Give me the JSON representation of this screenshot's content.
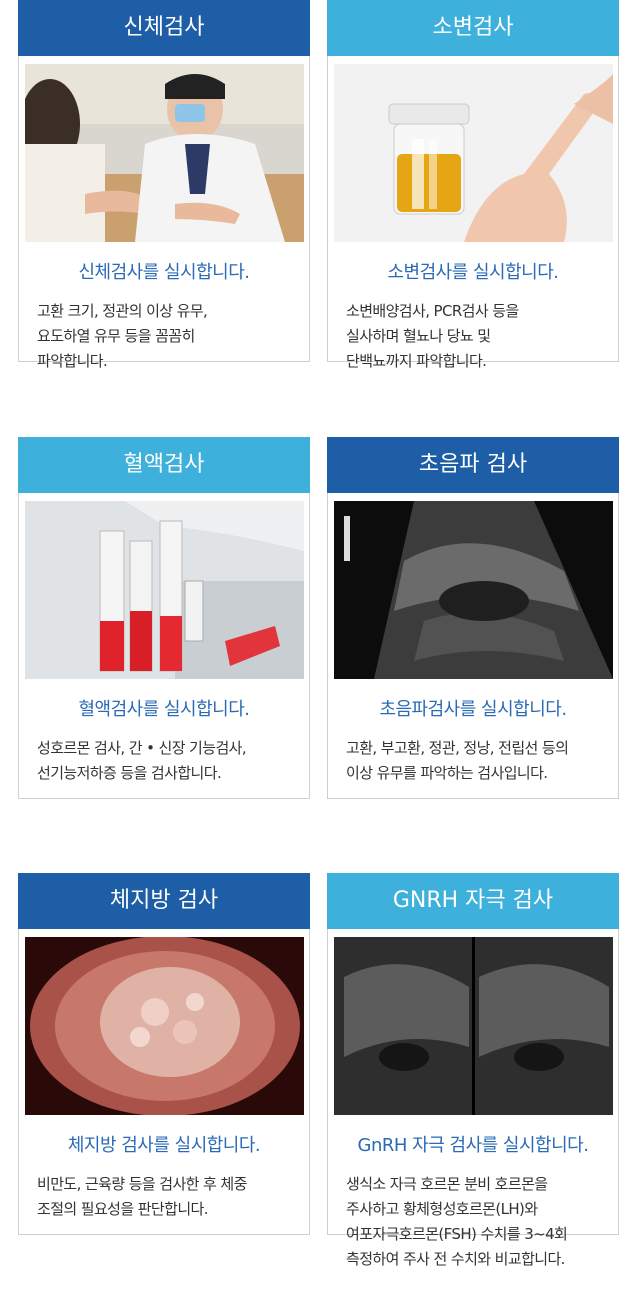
{
  "cards": [
    {
      "title": "신체검사",
      "subtitle": "신체검사를 실시합니다.",
      "desc": "고환 크기, 정관의 이상 유무,\n요도하열 유무 등을 꼼꼼히\n파악합니다.",
      "image": "physical-exam-photo"
    },
    {
      "title": "소변검사",
      "subtitle": "소변검사를 실시합니다.",
      "desc": "소변배양검사, PCR검사 등을\n실사하며 혈뇨나 당뇨 및\n단백뇨까지 파악합니다.",
      "image": "urine-sample-photo"
    },
    {
      "title": "혈액검사",
      "subtitle": "혈액검사를 실시합니다.",
      "desc": "성호르몬 검사, 간 • 신장 기능검사,\n선기능저하증 등을 검사합니다.",
      "image": "blood-tubes-photo"
    },
    {
      "title": "초음파 검사",
      "subtitle": "초음파검사를 실시합니다.",
      "desc": "고환, 부고환, 정관, 정낭, 전립선 등의\n이상 유무를 파악하는 검사입니다.",
      "image": "ultrasound-image"
    },
    {
      "title": "체지방 검사",
      "subtitle": "체지방 검사를 실시합니다.",
      "desc": "비만도, 근육량 등을 검사한 후 체중\n조절의 필요성을 판단합니다.",
      "image": "tissue-photo"
    },
    {
      "title": "GNRH 자극 검사",
      "subtitle": "GnRH 자극 검사를 실시합니다.",
      "desc": "생식소 자극 호르몬 분비 호르몬을\n주사하고 황체형성호르몬(LH)와\n여포자극호르몬(FSH) 수치를 3~4회\n측정하여 주사 전 수치와 비교합니다.",
      "image": "ultrasound-dual-image"
    }
  ],
  "colors": {
    "dark_header": "#1d5ea6",
    "light_header": "#3db1dc",
    "subtitle": "#2a6ab7"
  }
}
